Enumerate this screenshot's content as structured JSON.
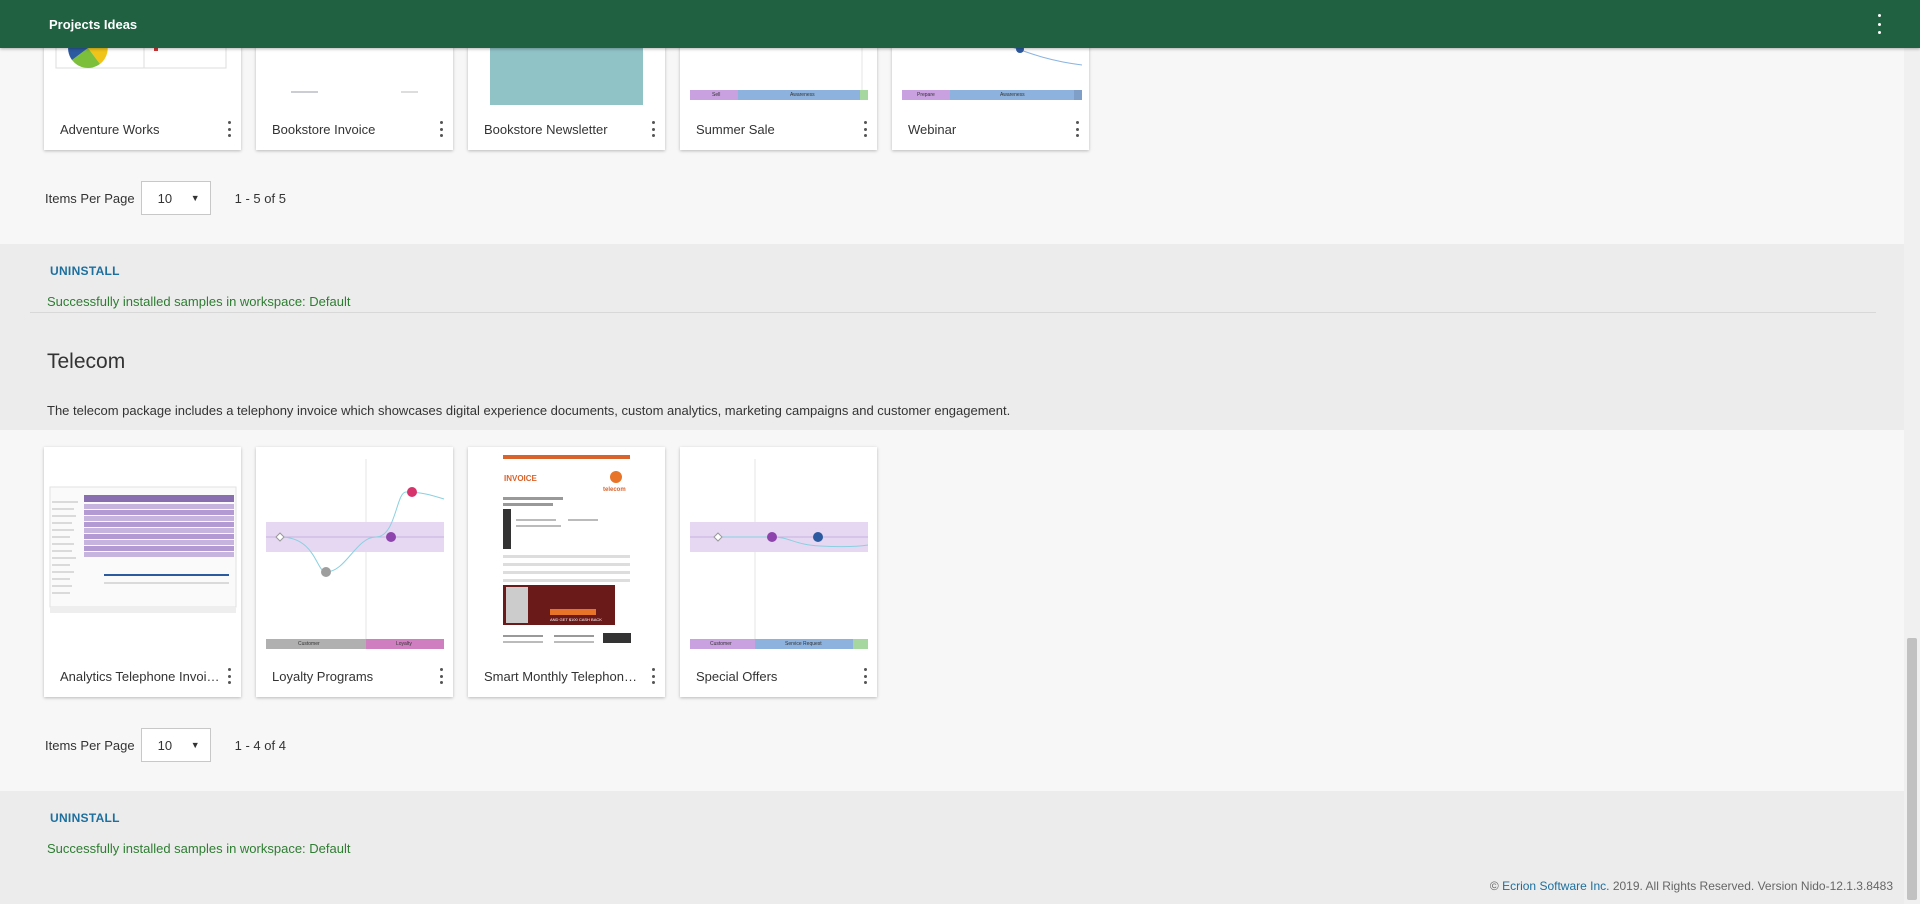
{
  "header": {
    "title": "Projects Ideas",
    "menu_icon": "more-vert-icon"
  },
  "colors": {
    "header_bg": "#1f6140",
    "link": "#1d6f9e",
    "success": "#2e7d32"
  },
  "section1": {
    "cards": [
      {
        "name": "Adventure Works"
      },
      {
        "name": "Bookstore Invoice"
      },
      {
        "name": "Bookstore Newsletter"
      },
      {
        "name": "Summer Sale"
      },
      {
        "name": "Webinar"
      }
    ],
    "items_per_page_label": "Items Per Page",
    "items_per_page_value": "10",
    "range": "1 - 5 of 5",
    "uninstall": "UNINSTALL",
    "success": "Successfully installed samples in workspace: Default",
    "thumb_text": {
      "summer_strip": [
        "Sell",
        "Awareness"
      ],
      "webinar_strip": [
        "Prepare",
        "Awareness"
      ]
    }
  },
  "section2": {
    "title": "Telecom",
    "description": "The telecom package includes a telephony invoice which showcases digital experience documents, custom analytics, marketing campaigns and customer engagement.",
    "cards": [
      {
        "name": "Analytics Telephone Invoice"
      },
      {
        "name": "Loyalty Programs"
      },
      {
        "name": "Smart Monthly Telephone Invoice"
      },
      {
        "name": "Special Offers"
      }
    ],
    "items_per_page_label": "Items Per Page",
    "items_per_page_value": "10",
    "range": "1 - 4 of 4",
    "uninstall": "UNINSTALL",
    "success": "Successfully installed samples in workspace: Default",
    "thumb_text": {
      "loyalty_strip": [
        "Customer",
        "Loyalty"
      ],
      "offers_strip": [
        "Customer",
        "Service Request"
      ],
      "invoice_heading": "INVOICE",
      "invoice_brand": "telecom",
      "invoice_promo": "AND GET $100 CASH BACK"
    }
  },
  "footer": {
    "copyright_prefix": "© ",
    "company": "Ecrion Software Inc.",
    "rest": " 2019. All Rights Reserved. Version Nido-12.1.3.8483"
  }
}
